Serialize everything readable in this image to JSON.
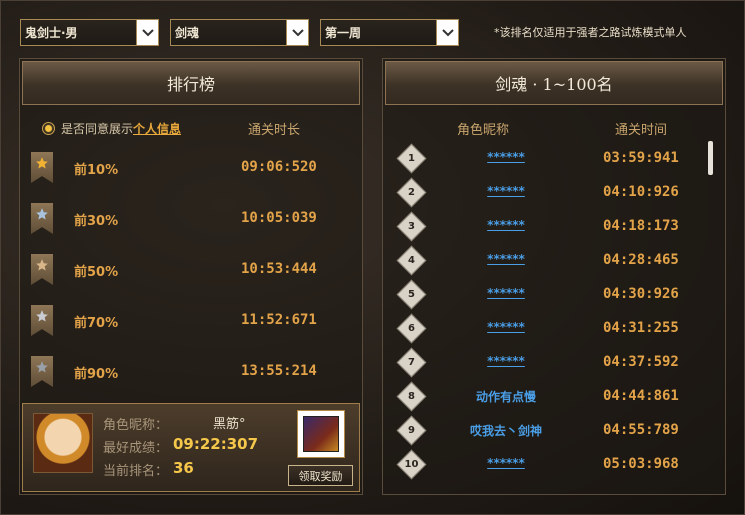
{
  "dropdowns": {
    "class": "鬼剑士·男",
    "subclass": "剑魂",
    "week": "第一周"
  },
  "notice": "*该排名仅适用于强者之路试炼模式单人",
  "left_panel": {
    "title": "排行榜",
    "consent_prefix": "是否同意展示",
    "consent_link": "个人信息",
    "col_time": "通关时长",
    "tiers": [
      {
        "label": "前10%",
        "time": "09:06:520",
        "medal": "gold"
      },
      {
        "label": "前30%",
        "time": "10:05:039",
        "medal": "blue"
      },
      {
        "label": "前50%",
        "time": "10:53:444",
        "medal": "bronze"
      },
      {
        "label": "前70%",
        "time": "11:52:671",
        "medal": "silver"
      },
      {
        "label": "前90%",
        "time": "13:55:214",
        "medal": "grey"
      }
    ]
  },
  "player": {
    "nick_label": "角色昵称：",
    "nick_value": "黑筋°",
    "best_label": "最好成绩：",
    "best_value": "09:22:307",
    "rank_label": "当前排名：",
    "rank_value": "36",
    "claim_button": "领取奖励"
  },
  "right_panel": {
    "title": "剑魂 · 1~100名",
    "col_nick": "角色昵称",
    "col_time": "通关时间",
    "entries": [
      {
        "rank": "1",
        "nick": "******",
        "time": "03:59:941",
        "masked": true
      },
      {
        "rank": "2",
        "nick": "******",
        "time": "04:10:926",
        "masked": true
      },
      {
        "rank": "3",
        "nick": "******",
        "time": "04:18:173",
        "masked": true
      },
      {
        "rank": "4",
        "nick": "******",
        "time": "04:28:465",
        "masked": true
      },
      {
        "rank": "5",
        "nick": "******",
        "time": "04:30:926",
        "masked": true
      },
      {
        "rank": "6",
        "nick": "******",
        "time": "04:31:255",
        "masked": true
      },
      {
        "rank": "7",
        "nick": "******",
        "time": "04:37:592",
        "masked": true
      },
      {
        "rank": "8",
        "nick": "动作有点慢",
        "time": "04:44:861",
        "masked": false
      },
      {
        "rank": "9",
        "nick": "哎我去丶剑神",
        "time": "04:55:789",
        "masked": false
      },
      {
        "rank": "10",
        "nick": "******",
        "time": "05:03:968",
        "masked": true
      }
    ]
  },
  "colors": {
    "accent_gold": "#e3a349",
    "link_blue": "#4a9ee6",
    "highlight_yellow": "#f5c74a"
  }
}
